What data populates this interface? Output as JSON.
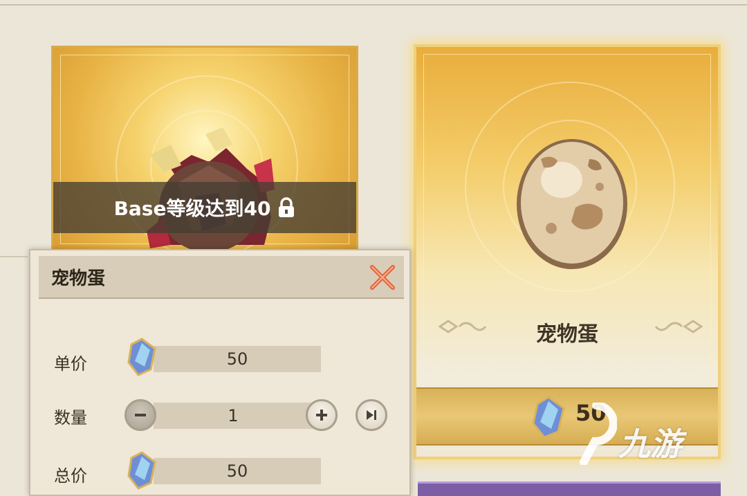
{
  "shop": {
    "locked_item": {
      "lock_text": "Base等级达到40",
      "icon": "lock-icon",
      "image": "ore-chunk"
    },
    "featured_item": {
      "name": "宠物蛋",
      "price": "50",
      "price_icon": "crystal-icon",
      "image": "pet-egg"
    }
  },
  "purchase_dialog": {
    "title": "宠物蛋",
    "close_icon": "close-icon",
    "unit_price": {
      "label": "单价",
      "value": "50",
      "icon": "crystal-icon"
    },
    "quantity": {
      "label": "数量",
      "value": "1",
      "minus_icon": "minus-icon",
      "plus_icon": "plus-icon",
      "max_icon": "skip-to-max-icon"
    },
    "total": {
      "label": "总价",
      "value": "50",
      "icon": "crystal-icon"
    }
  },
  "watermark": {
    "text": "九游"
  },
  "colors": {
    "gold": "#f4ce6c",
    "frame": "#d9ab4a",
    "dialog_bg": "#efe7d7",
    "close_accent": "#e8603a",
    "purple": "#7b5ea6"
  }
}
